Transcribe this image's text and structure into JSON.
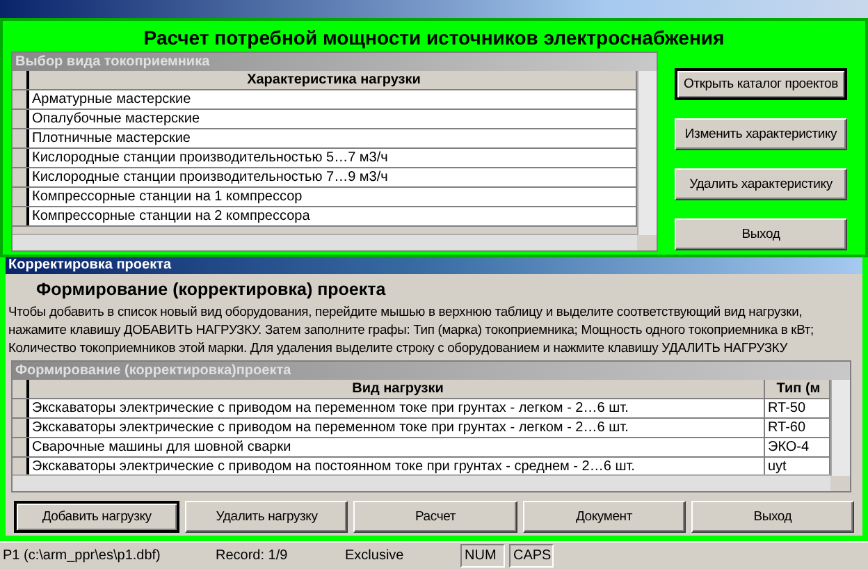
{
  "main_panel": {
    "title": "Расчет потребной мощности источников электроснабжения",
    "grid": {
      "caption": "Выбор вида токоприемника",
      "columns": [
        "Характеристика нагрузки"
      ],
      "rows": [
        [
          "Арматурные мастерские"
        ],
        [
          "Опалубочные мастерские"
        ],
        [
          "Плотничные мастерские"
        ],
        [
          "Кислородные станции производительностью 5…7 м3/ч"
        ],
        [
          "Кислородные станции производительностью 7…9 м3/ч"
        ],
        [
          "Компрессорные станции на 1  компрессор"
        ],
        [
          "Компрессорные станции на  2 компрессора"
        ]
      ]
    },
    "buttons": [
      {
        "label": "Открыть каталог проектов",
        "focused": true
      },
      {
        "label": "Изменить характеристику",
        "focused": false
      },
      {
        "label": "Удалить характеристику",
        "focused": false
      },
      {
        "label": "Выход",
        "focused": false
      }
    ]
  },
  "project_window": {
    "title": "Корректировка проекта",
    "heading": "Формирование (корректировка) проекта",
    "instructions": "Чтобы добавить в список новый вид оборудования, перейдите мышью в верхнюю таблицу и выделите соответствующий вид нагрузки, нажамите клавишу ДОБАВИТЬ НАГРУЗКУ. Затем заполните графы: Тип (марка) токоприемника; Мощность одного токоприемника в кВт; Количество токоприемников этой марки. Для удаления выделите строку с оборудованием и нажмите клавишу УДАЛИТЬ НАГРУЗКУ",
    "grid": {
      "caption": "Формирование (корректировка)проекта",
      "columns": [
        "Вид нагрузки",
        "Тип (м"
      ],
      "rows": [
        [
          "Экскаваторы электрические с приводом на переменном токе при грунтах -  легком - 2…6 шт.",
          "RT-50"
        ],
        [
          "Экскаваторы электрические с приводом на переменном токе при грунтах -  легком - 2…6 шт.",
          "RT-60"
        ],
        [
          "Сварочные машины для шовной сварки",
          "ЭКО-4"
        ],
        [
          "Экскаваторы электрические с приводом на постоянном токе при грунтах -  среднем - 2…6 шт.",
          "uyt"
        ]
      ]
    },
    "buttons": [
      {
        "label": "Добавить нагрузку",
        "focused": true
      },
      {
        "label": "Удалить нагрузку",
        "focused": false
      },
      {
        "label": "Расчет",
        "focused": false
      },
      {
        "label": "Документ",
        "focused": false
      },
      {
        "label": "Выход",
        "focused": false
      }
    ]
  },
  "status_bar": [
    "P1 (c:\\arm_ppr\\es\\p1.dbf)",
    "Record: 1/9",
    "Exclusive",
    "NUM",
    "CAPS"
  ]
}
